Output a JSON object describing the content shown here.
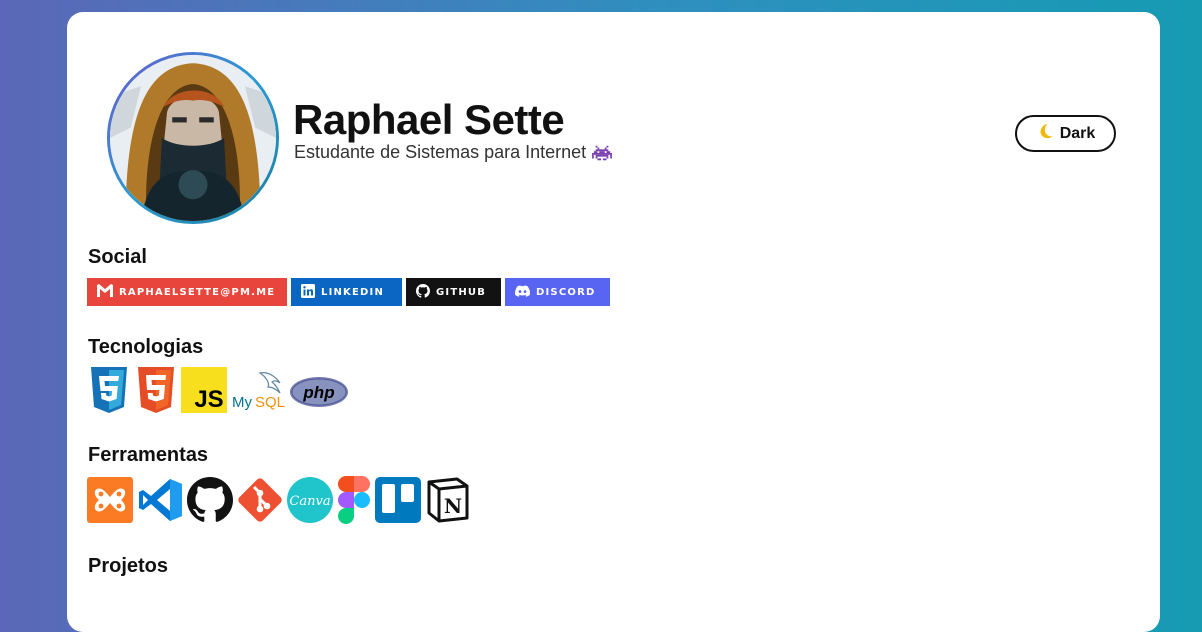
{
  "profile": {
    "name": "Raphael Sette",
    "subtitle": "Estudante de Sistemas para Internet",
    "subtitle_emoji": "space-invader-icon"
  },
  "theme_toggle": {
    "icon": "moon-icon",
    "label": "Dark"
  },
  "social": {
    "title": "Social",
    "badges": [
      {
        "label": "RAPHAELSETTE@PM.ME",
        "icon": "gmail-icon",
        "color": "#e8453c"
      },
      {
        "label": "LINKEDIN",
        "icon": "linkedin-icon",
        "color": "#0a66c2"
      },
      {
        "label": "GITHUB",
        "icon": "github-icon",
        "color": "#121212"
      },
      {
        "label": "DISCORD",
        "icon": "discord-icon",
        "color": "#5865f2"
      }
    ]
  },
  "tecnologias": {
    "title": "Tecnologias",
    "items": [
      {
        "name": "CSS3",
        "icon": "css3-icon"
      },
      {
        "name": "HTML5",
        "icon": "html5-icon"
      },
      {
        "name": "JS",
        "icon": "javascript-icon"
      },
      {
        "name": "MySQL",
        "icon": "mysql-icon"
      },
      {
        "name": "php",
        "icon": "php-icon"
      }
    ]
  },
  "ferramentas": {
    "title": "Ferramentas",
    "items": [
      {
        "name": "XAMPP",
        "icon": "xampp-icon"
      },
      {
        "name": "VS Code",
        "icon": "vscode-icon"
      },
      {
        "name": "GitHub",
        "icon": "github-icon"
      },
      {
        "name": "Git",
        "icon": "git-icon"
      },
      {
        "name": "Canva",
        "icon": "canva-icon"
      },
      {
        "name": "Figma",
        "icon": "figma-icon"
      },
      {
        "name": "Trello",
        "icon": "trello-icon"
      },
      {
        "name": "Notion",
        "icon": "notion-icon"
      }
    ]
  },
  "projetos": {
    "title": "Projetos"
  }
}
